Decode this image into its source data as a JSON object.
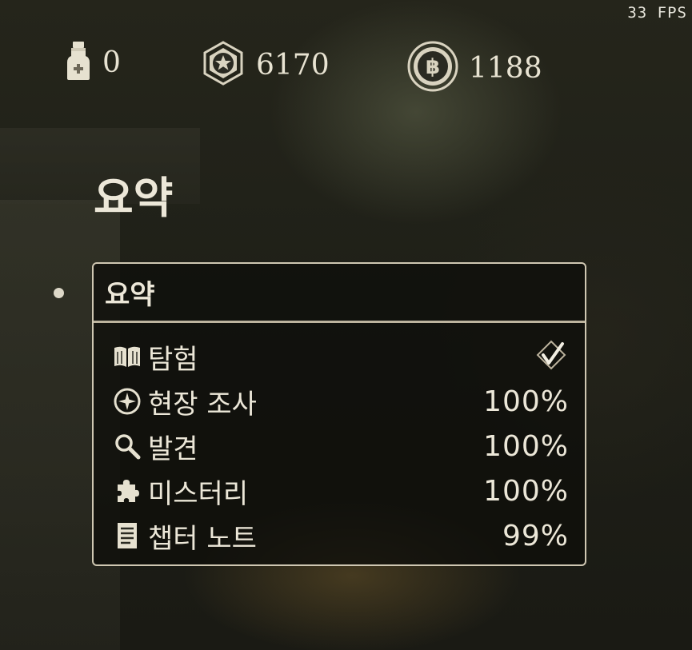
{
  "fps": "33 FPS",
  "currencies": [
    {
      "icon": "potion-bottle-icon",
      "value": "0"
    },
    {
      "icon": "star-hexagon-icon",
      "value": "6170"
    },
    {
      "icon": "baht-coin-icon",
      "value": "1188"
    }
  ],
  "page_title": "요약",
  "panel": {
    "header": "요약",
    "rows": [
      {
        "icon": "open-book-icon",
        "label": "탐험",
        "value": ""
      },
      {
        "icon": "compass-icon",
        "label": "현장 조사",
        "value": "100%"
      },
      {
        "icon": "magnifier-icon",
        "label": "발견",
        "value": "100%"
      },
      {
        "icon": "puzzle-piece-icon",
        "label": "미스터리",
        "value": "100%"
      },
      {
        "icon": "notes-page-icon",
        "label": "챕터 노트",
        "value": "99%"
      }
    ]
  },
  "colors": {
    "text": "#ece7d8",
    "border": "#cfc7b2",
    "panel_bg": "#0e0e0a"
  }
}
